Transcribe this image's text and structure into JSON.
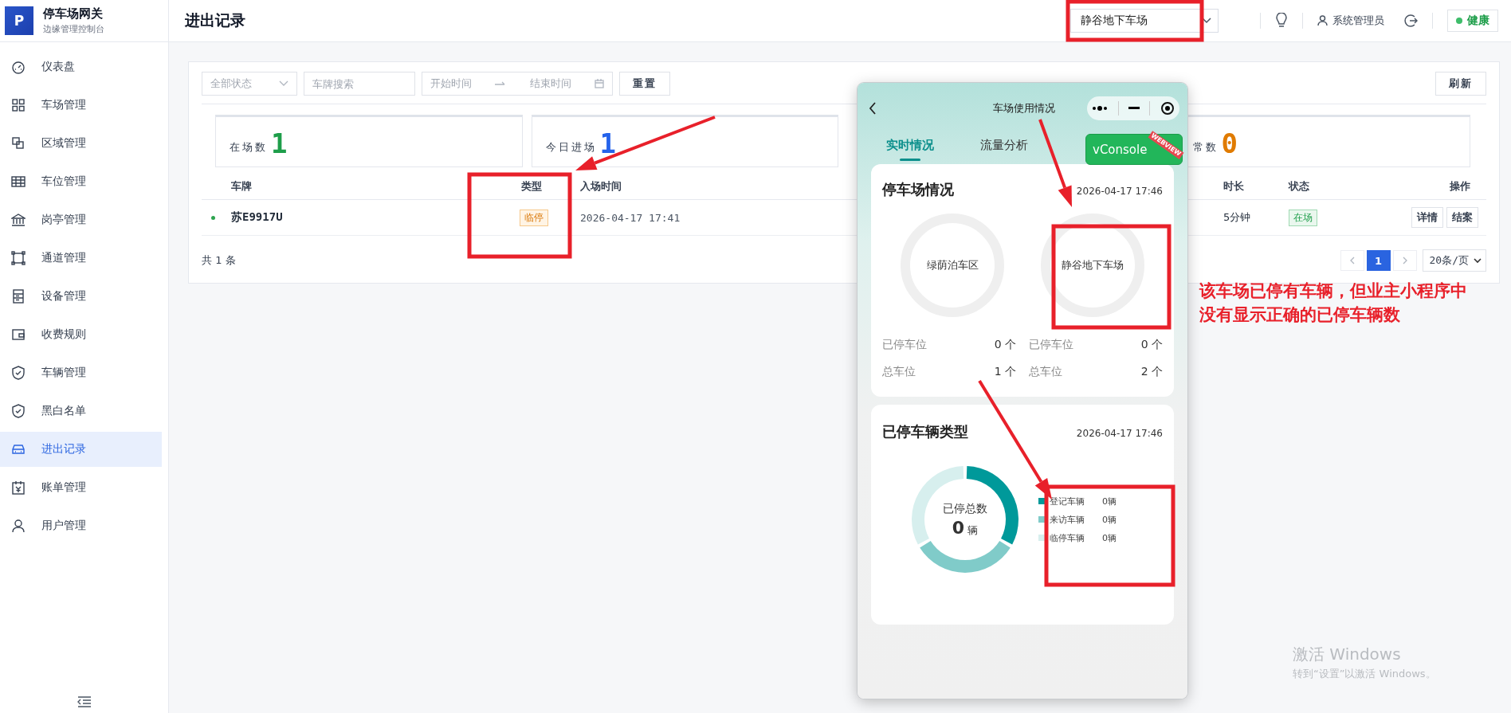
{
  "sidebar": {
    "logo_letter": "P",
    "title": "停车场网关",
    "subtitle": "边缘管理控制台",
    "items": [
      {
        "label": "仪表盘",
        "selected": false
      },
      {
        "label": "车场管理",
        "selected": false
      },
      {
        "label": "区域管理",
        "selected": false
      },
      {
        "label": "车位管理",
        "selected": false
      },
      {
        "label": "岗亭管理",
        "selected": false
      },
      {
        "label": "通道管理",
        "selected": false
      },
      {
        "label": "设备管理",
        "selected": false
      },
      {
        "label": "收费规则",
        "selected": false
      },
      {
        "label": "车辆管理",
        "selected": false
      },
      {
        "label": "黑白名单",
        "selected": false
      },
      {
        "label": "进出记录",
        "selected": true
      },
      {
        "label": "账单管理",
        "selected": false
      },
      {
        "label": "用户管理",
        "selected": false
      }
    ]
  },
  "header": {
    "title": "进出记录",
    "lot_select": "静谷地下车场",
    "user": "系统管理员",
    "health": "健康"
  },
  "filters": {
    "status_select": "全部状态",
    "plate_search": {
      "placeholder": "车牌搜索"
    },
    "date_range": {
      "start_placeholder": "开始时间",
      "end_placeholder": "结束时间"
    },
    "reset_button": "重置",
    "refresh_button": "刷新"
  },
  "stats": [
    {
      "label": "在场数",
      "value": "1",
      "color": "#1e9e4a"
    },
    {
      "label": "今日进场",
      "value": "1",
      "color": "#2563eb"
    },
    {
      "label": "常数",
      "value": "0",
      "color": "#e07b00"
    }
  ],
  "table": {
    "columns": [
      "车牌",
      "类型",
      "入场时间",
      "时长",
      "状态",
      "操作"
    ],
    "rows": [
      {
        "plate": "苏E9917U",
        "type": "临停",
        "entry_time": "2026-04-17 17:41",
        "duration": "5分钟",
        "status": "在场",
        "actions": [
          "详情",
          "结案"
        ]
      }
    ],
    "total": "共 1 条"
  },
  "pagination": {
    "pages": [
      {
        "label": "1",
        "selected": true
      }
    ],
    "page_size": "20条/页"
  },
  "phone": {
    "title": "车场使用情况",
    "tabs": [
      {
        "label": "实时情况",
        "selected": true
      },
      {
        "label": "流量分析",
        "selected": false
      }
    ],
    "vconsole": {
      "label": "vConsole",
      "ribbon": "WEBVIEW"
    },
    "lot_card": {
      "title": "停车场情况",
      "time": "2026-04-17 17:46",
      "lots": [
        {
          "name": "绿荫泊车区",
          "stats": [
            {
              "label": "已停车位",
              "value": "0 个"
            },
            {
              "label": "总车位",
              "value": "1 个"
            }
          ]
        },
        {
          "name": "静谷地下车场",
          "stats": [
            {
              "label": "已停车位",
              "value": "0 个"
            },
            {
              "label": "总车位",
              "value": "2 个"
            }
          ]
        }
      ]
    },
    "type_card": {
      "title": "已停车辆类型",
      "time": "2026-04-17 17:46",
      "center_label": "已停总数",
      "center_value": "0",
      "center_unit": "辆",
      "legend": [
        {
          "label": "登记车辆",
          "value": "0辆",
          "color": "#00999a"
        },
        {
          "label": "来访车辆",
          "value": "0辆",
          "color": "#80cbc9"
        },
        {
          "label": "临停车辆",
          "value": "0辆",
          "color": "#d7efee"
        }
      ]
    }
  },
  "annotation": {
    "note": "该车场已停有车辆，但业主小程序中没有显示正确的已停车辆数"
  },
  "windows_notice": {
    "title": "激活 Windows",
    "text": "转到“设置”以激活 Windows。"
  }
}
